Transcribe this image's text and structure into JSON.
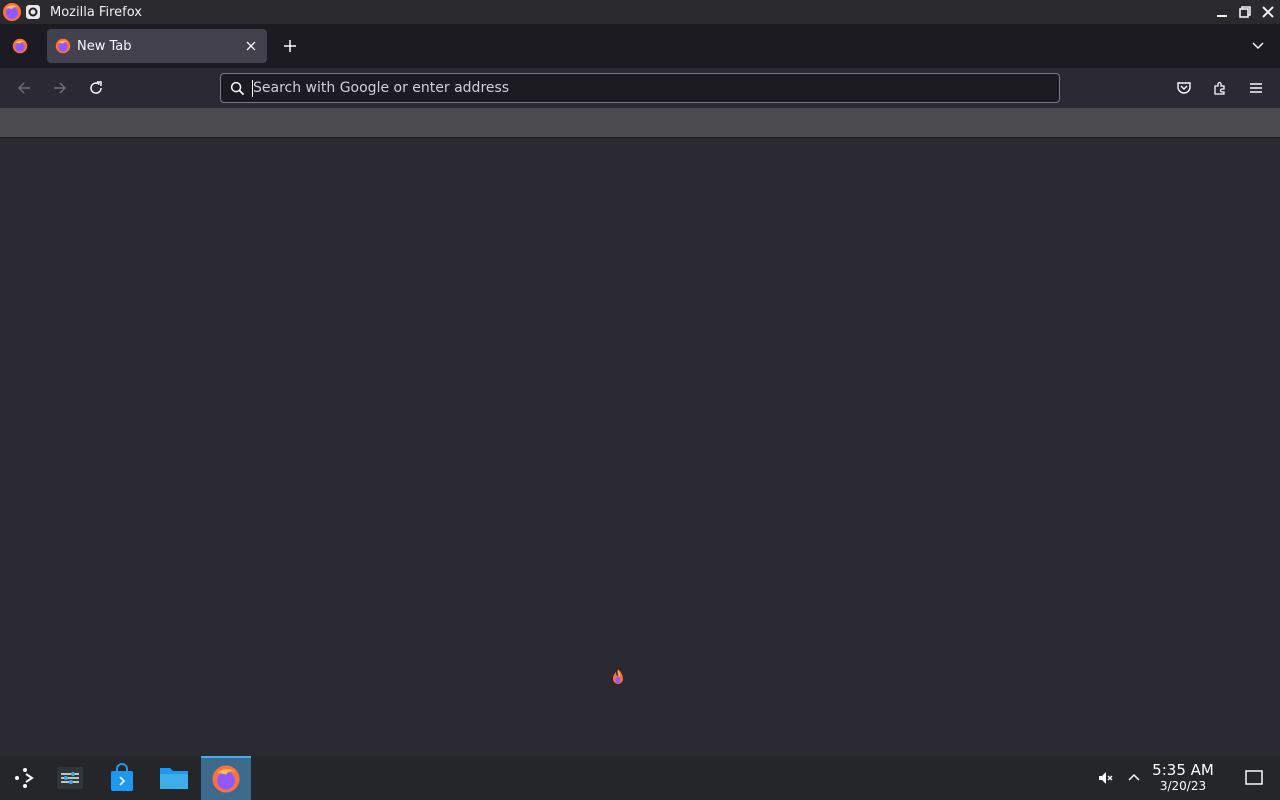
{
  "window": {
    "title": "Mozilla Firefox",
    "app_icon": "firefox-icon",
    "controls": [
      "minimize-icon",
      "restore-icon",
      "close-icon"
    ]
  },
  "tabs": [
    {
      "label": "New Tab",
      "favicon": "firefox-icon",
      "active": true
    }
  ],
  "toolbar": {
    "back_icon": "back-arrow-icon",
    "forward_icon": "forward-arrow-icon",
    "reload_icon": "reload-icon",
    "urlbar": {
      "placeholder": "Search with Google or enter address",
      "value": ""
    },
    "right_icons": [
      "pocket-icon",
      "extensions-icon",
      "hamburger-menu-icon"
    ]
  },
  "taskbar": {
    "launchers": [
      "app-launcher-icon",
      "system-settings-icon",
      "discover-store-icon",
      "file-manager-icon",
      "firefox-icon"
    ],
    "active_launcher": "firefox-icon",
    "tray_icons": [
      "volume-muted-icon",
      "tray-expand-icon"
    ],
    "clock": {
      "time": "5:35 AM",
      "date": "3/20/23"
    },
    "show_desktop_icon": "show-desktop-icon"
  },
  "colors": {
    "accent": "#3daee9",
    "content_bg": "#2b2a33",
    "tabstrip_bg": "#1c1b22",
    "bookmarks_bg": "#4a4a4f"
  }
}
